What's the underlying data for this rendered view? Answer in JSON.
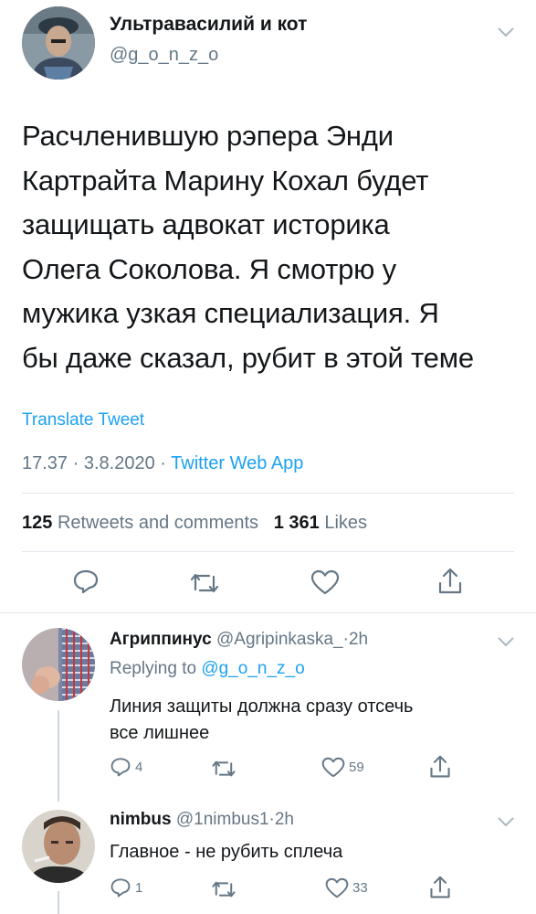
{
  "main_tweet": {
    "display_name": "Ультравасилий и кот",
    "handle": "@g_o_n_z_o",
    "text_lines": [
      "Расчленившую рэпера Энди",
      "Картрайта Марину Кохал будет",
      "защищать адвокат историка",
      "Олега Соколова. Я смотрю у",
      "мужика узкая специализация. Я",
      "бы даже сказал, рубит в этой теме"
    ],
    "translate": "Translate Tweet",
    "time": "17.37",
    "date": "3.8.2020",
    "source": "Twitter Web App",
    "retweets_count": "125",
    "retweets_label": "Retweets and comments",
    "likes_count": "1 361",
    "likes_label": "Likes"
  },
  "replies": [
    {
      "display_name": "Агриппинус",
      "handle": "@Agripinkaska_",
      "time": "2h",
      "replying_prefix": "Replying to",
      "replying_handle": "@g_o_n_z_o",
      "text_lines": [
        "Линия защиты должна сразу отсечь",
        "все лишнее"
      ],
      "reply_count": "4",
      "like_count": "59"
    },
    {
      "display_name": "nimbus",
      "handle": "@1nimbus1",
      "time": "2h",
      "text_lines": [
        "Главное - не рубить сплеча"
      ],
      "reply_count": "1",
      "like_count": "33"
    }
  ],
  "separator": "·",
  "colors": {
    "accent": "#1da1f2",
    "secondary": "#657786",
    "text": "#14171a",
    "divider": "#e1e8ed"
  }
}
